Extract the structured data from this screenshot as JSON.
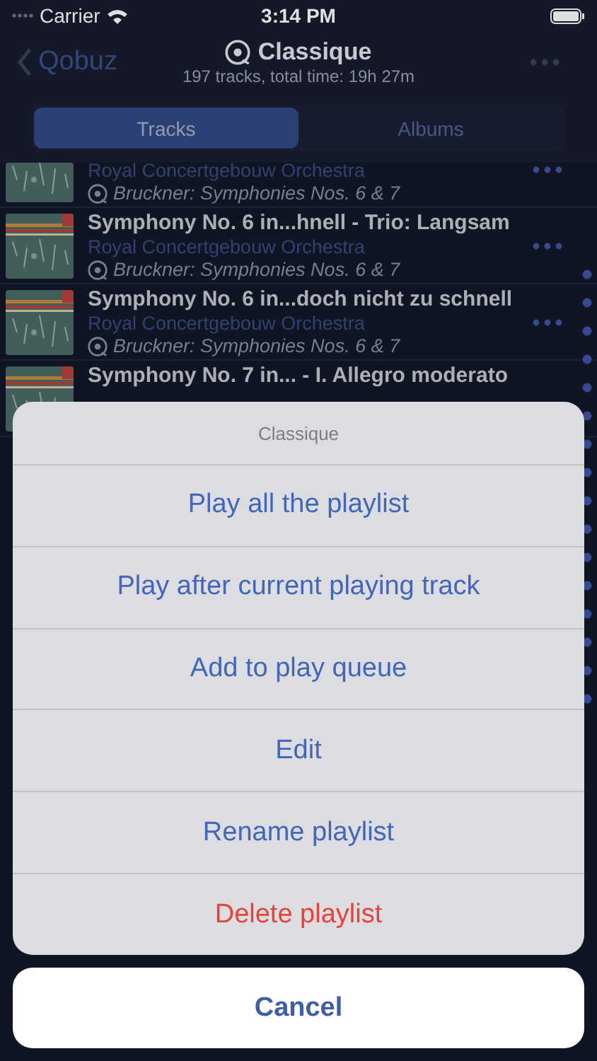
{
  "status_bar": {
    "carrier": "Carrier",
    "time": "3:14 PM"
  },
  "nav": {
    "back": "Qobuz",
    "title": "Classique",
    "subtitle": "197 tracks, total time: 19h 27m"
  },
  "tabs": [
    {
      "label": "Tracks",
      "selected": true
    },
    {
      "label": "Albums",
      "selected": false
    }
  ],
  "tracks": [
    {
      "artist": "Royal Concertgebouw Orchestra",
      "album": "Bruckner: Symphonies Nos. 6 & 7"
    },
    {
      "title": "Symphony No. 6 in...hnell - Trio: Langsam",
      "artist": "Royal Concertgebouw Orchestra",
      "album": "Bruckner: Symphonies Nos. 6 & 7"
    },
    {
      "title": "Symphony No. 6 in...doch nicht zu schnell",
      "artist": "Royal Concertgebouw Orchestra",
      "album": "Bruckner: Symphonies Nos. 6 & 7"
    },
    {
      "title": "Symphony No. 7 in... - I. Allegro moderato"
    }
  ],
  "action_sheet": {
    "title": "Classique",
    "actions": [
      {
        "label": "Play all the playlist",
        "kind": "default"
      },
      {
        "label": "Play after current playing track",
        "kind": "default"
      },
      {
        "label": "Add to play queue",
        "kind": "default"
      },
      {
        "label": "Edit",
        "kind": "default"
      },
      {
        "label": "Rename playlist",
        "kind": "default"
      },
      {
        "label": "Delete playlist",
        "kind": "destructive"
      }
    ],
    "cancel": "Cancel"
  }
}
